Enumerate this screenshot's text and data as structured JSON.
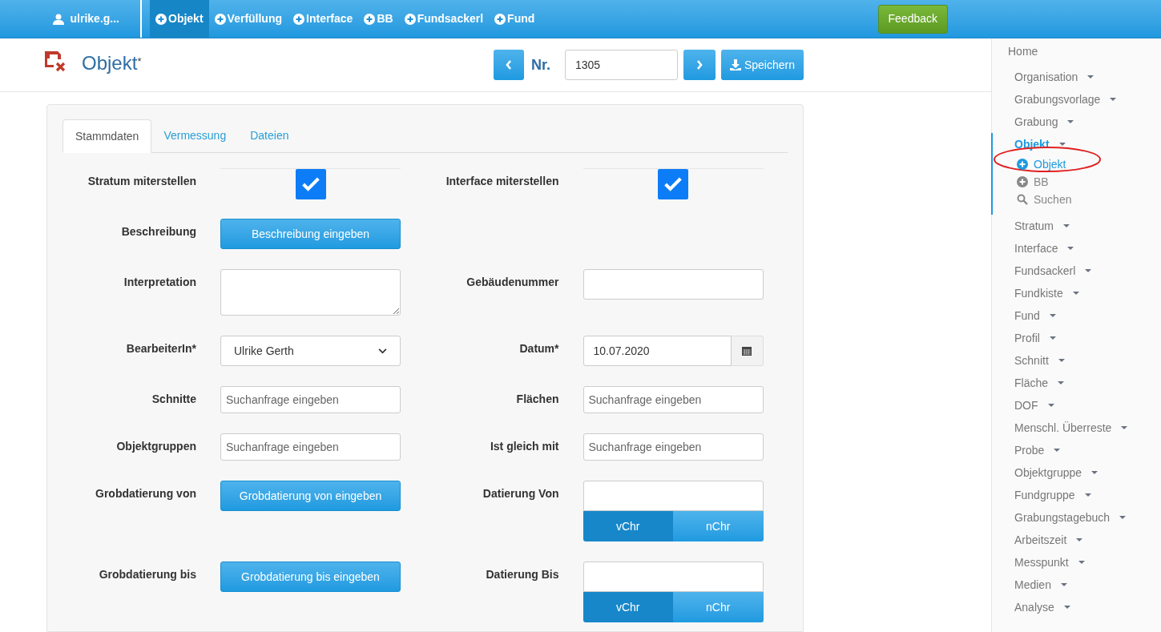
{
  "topbar": {
    "user": "ulrike.g...",
    "nav": [
      {
        "label": "Objekt",
        "selected": true
      },
      {
        "label": "Verfüllung",
        "selected": false
      },
      {
        "label": "Interface",
        "selected": false
      },
      {
        "label": "BB",
        "selected": false
      },
      {
        "label": "Fundsackerl",
        "selected": false
      },
      {
        "label": "Fund",
        "selected": false
      }
    ],
    "feedback": "Feedback"
  },
  "header": {
    "title": "Objekt",
    "title_mark": "*",
    "nr_label": "Nr.",
    "nr_value": "1305",
    "save": "Speichern"
  },
  "tabs": [
    {
      "label": "Stammdaten",
      "selected": true
    },
    {
      "label": "Vermessung",
      "selected": false
    },
    {
      "label": "Dateien",
      "selected": false
    }
  ],
  "form": [
    {
      "left": {
        "kind": "checkbox",
        "label": "Stratum miterstellen",
        "checked": true
      },
      "right": {
        "kind": "checkbox",
        "label": "Interface miterstellen",
        "checked": true
      }
    },
    {
      "left": {
        "kind": "button",
        "label": "Beschreibung",
        "button": "Beschreibung eingeben"
      }
    },
    {
      "left": {
        "kind": "textarea",
        "label": "Interpretation"
      },
      "right": {
        "kind": "text",
        "label": "Gebäudenummer"
      }
    },
    {
      "left": {
        "kind": "select",
        "label": "BearbeiterIn*",
        "value": "Ulrike Gerth"
      },
      "right": {
        "kind": "date",
        "label": "Datum*",
        "value": "10.07.2020"
      }
    },
    {
      "left": {
        "kind": "search",
        "label": "Schnitte",
        "placeholder": "Suchanfrage eingeben"
      },
      "right": {
        "kind": "search",
        "label": "Flächen",
        "placeholder": "Suchanfrage eingeben"
      }
    },
    {
      "left": {
        "kind": "search",
        "label": "Objektgruppen",
        "placeholder": "Suchanfrage eingeben"
      },
      "right": {
        "kind": "search",
        "label": "Ist gleich mit",
        "placeholder": "Suchanfrage eingeben"
      }
    },
    {
      "left": {
        "kind": "button",
        "label": "Grobdatierung von",
        "button": "Grobdatierung von eingeben"
      },
      "right": {
        "kind": "dating",
        "label": "Datierung Von",
        "options": [
          {
            "label": "vChr",
            "selected": true
          },
          {
            "label": "nChr",
            "selected": false
          }
        ]
      }
    },
    {
      "left": {
        "kind": "button",
        "label": "Grobdatierung bis",
        "button": "Grobdatierung bis eingeben"
      },
      "right": {
        "kind": "dating",
        "label": "Datierung Bis",
        "options": [
          {
            "label": "vChr",
            "selected": true
          },
          {
            "label": "nChr",
            "selected": false
          }
        ]
      }
    }
  ],
  "sidebar": {
    "home": "Home",
    "items": [
      {
        "label": "Organisation",
        "expanded": false
      },
      {
        "label": "Grabungsvorlage",
        "expanded": false
      },
      {
        "label": "Grabung",
        "expanded": false
      },
      {
        "label": "Objekt",
        "expanded": true,
        "children": [
          {
            "kind": "add",
            "label": "Objekt",
            "selected": true
          },
          {
            "kind": "add",
            "label": "BB",
            "selected": false
          },
          {
            "kind": "search",
            "label": "Suchen",
            "selected": false
          }
        ]
      },
      {
        "label": "Stratum",
        "expanded": false
      },
      {
        "label": "Interface",
        "expanded": false
      },
      {
        "label": "Fundsackerl",
        "expanded": false
      },
      {
        "label": "Fundkiste",
        "expanded": false
      },
      {
        "label": "Fund",
        "expanded": false
      },
      {
        "label": "Profil",
        "expanded": false
      },
      {
        "label": "Schnitt",
        "expanded": false
      },
      {
        "label": "Fläche",
        "expanded": false
      },
      {
        "label": "DOF",
        "expanded": false
      },
      {
        "label": "Menschl. Überreste",
        "expanded": false
      },
      {
        "label": "Probe",
        "expanded": false
      },
      {
        "label": "Objektgruppe",
        "expanded": false
      },
      {
        "label": "Fundgruppe",
        "expanded": false
      },
      {
        "label": "Grabungstagebuch",
        "expanded": false
      },
      {
        "label": "Arbeitszeit",
        "expanded": false
      },
      {
        "label": "Messpunkt",
        "expanded": false
      },
      {
        "label": "Medien",
        "expanded": false
      },
      {
        "label": "Analyse",
        "expanded": false
      }
    ]
  }
}
